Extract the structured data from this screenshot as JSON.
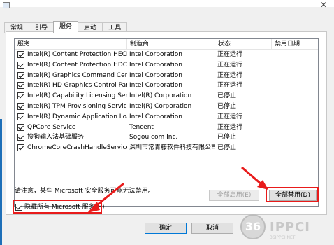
{
  "tabs": [
    {
      "label": "常规"
    },
    {
      "label": "引导"
    },
    {
      "label": "服务"
    },
    {
      "label": "启动"
    },
    {
      "label": "工具"
    }
  ],
  "columns": {
    "service": "服务",
    "maker": "制造商",
    "status": "状态",
    "disabled_date": "禁用日期"
  },
  "services": [
    {
      "name": "Intel(R) Content Protection HECI ...",
      "maker": "Intel Corporation",
      "status": "正在运行",
      "checked": true
    },
    {
      "name": "Intel(R) Content Protection HDCP...",
      "maker": "Intel Corporation",
      "status": "正在运行",
      "checked": true
    },
    {
      "name": "Intel(R) Graphics Command Cent...",
      "maker": "Intel Corporation",
      "status": "正在运行",
      "checked": true
    },
    {
      "name": "Intel(R) HD Graphics Control Pan...",
      "maker": "Intel Corporation",
      "status": "正在运行",
      "checked": true
    },
    {
      "name": "Intel(R) Capability Licensing Servi...",
      "maker": "Intel(R) Corporation",
      "status": "已停止",
      "checked": true
    },
    {
      "name": "Intel(R) TPM Provisioning Service",
      "maker": "Intel(R) Corporation",
      "status": "已停止",
      "checked": true
    },
    {
      "name": "Intel(R) Dynamic Application Loa...",
      "maker": "Intel Corporation",
      "status": "正在运行",
      "checked": true
    },
    {
      "name": "QPCore Service",
      "maker": "Tencent",
      "status": "正在运行",
      "checked": true
    },
    {
      "name": "搜狗输入法基础服务",
      "maker": "Sogou.com Inc.",
      "status": "已停止",
      "checked": true
    },
    {
      "name": "ChromeCoreCrashHandleService",
      "maker": "深圳市常青藤软件科技有限公司",
      "status": "已停止",
      "checked": true
    }
  ],
  "note": "请注意，某些 Microsoft 安全服务可能无法禁用。",
  "enable_all_label": "全部启用(E)",
  "disable_all_label": "全部禁用(D)",
  "hide_ms_label": "隐藏所有 Microsoft 服务(H)",
  "hide_ms_checked": true,
  "ok_label": "确定",
  "cancel_label": "取消",
  "close_glyph": "✕",
  "watermark": {
    "badge": "36",
    "text": "IPPCI",
    "small": "36IPPCI.NET"
  },
  "colors": {
    "highlight": "#e81b1b",
    "accent": "#0078d7"
  }
}
